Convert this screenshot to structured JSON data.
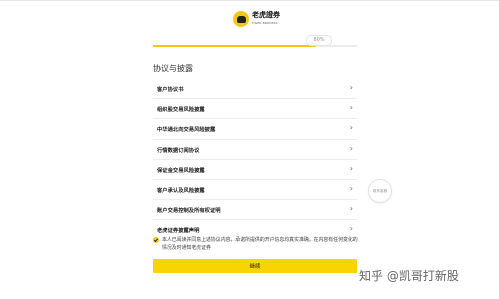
{
  "header": {
    "brand_name": "老虎證券",
    "brand_subtitle": "TIGER BROKERS"
  },
  "progress": {
    "label": "80%",
    "value": 0.8
  },
  "section": {
    "title": "协议与披露"
  },
  "agreements": [
    {
      "label": "客户协议书"
    },
    {
      "label": "组织股交易风险披露"
    },
    {
      "label": "中华通北向交易风险披露"
    },
    {
      "label": "行情数据订阅协议"
    },
    {
      "label": "保证金交易风险披露"
    },
    {
      "label": "客户承认及风险披露"
    },
    {
      "label": "账户交易控制及所有权证明"
    },
    {
      "label": "老虎证券披露声明"
    }
  ],
  "side_button": {
    "label": "联系客服"
  },
  "consent": {
    "checked": true,
    "text": "本人已阅读并同意上述协议内容，承诺所提供的开户信息均真实准确，在内容有任何变化的情况及时通知老虎证券"
  },
  "actions": {
    "continue_label": "继续"
  },
  "watermark": {
    "text": "知乎 @凯哥打新股"
  },
  "colors": {
    "accent": "#f8d400",
    "brand_yellow": "#f5c518"
  }
}
